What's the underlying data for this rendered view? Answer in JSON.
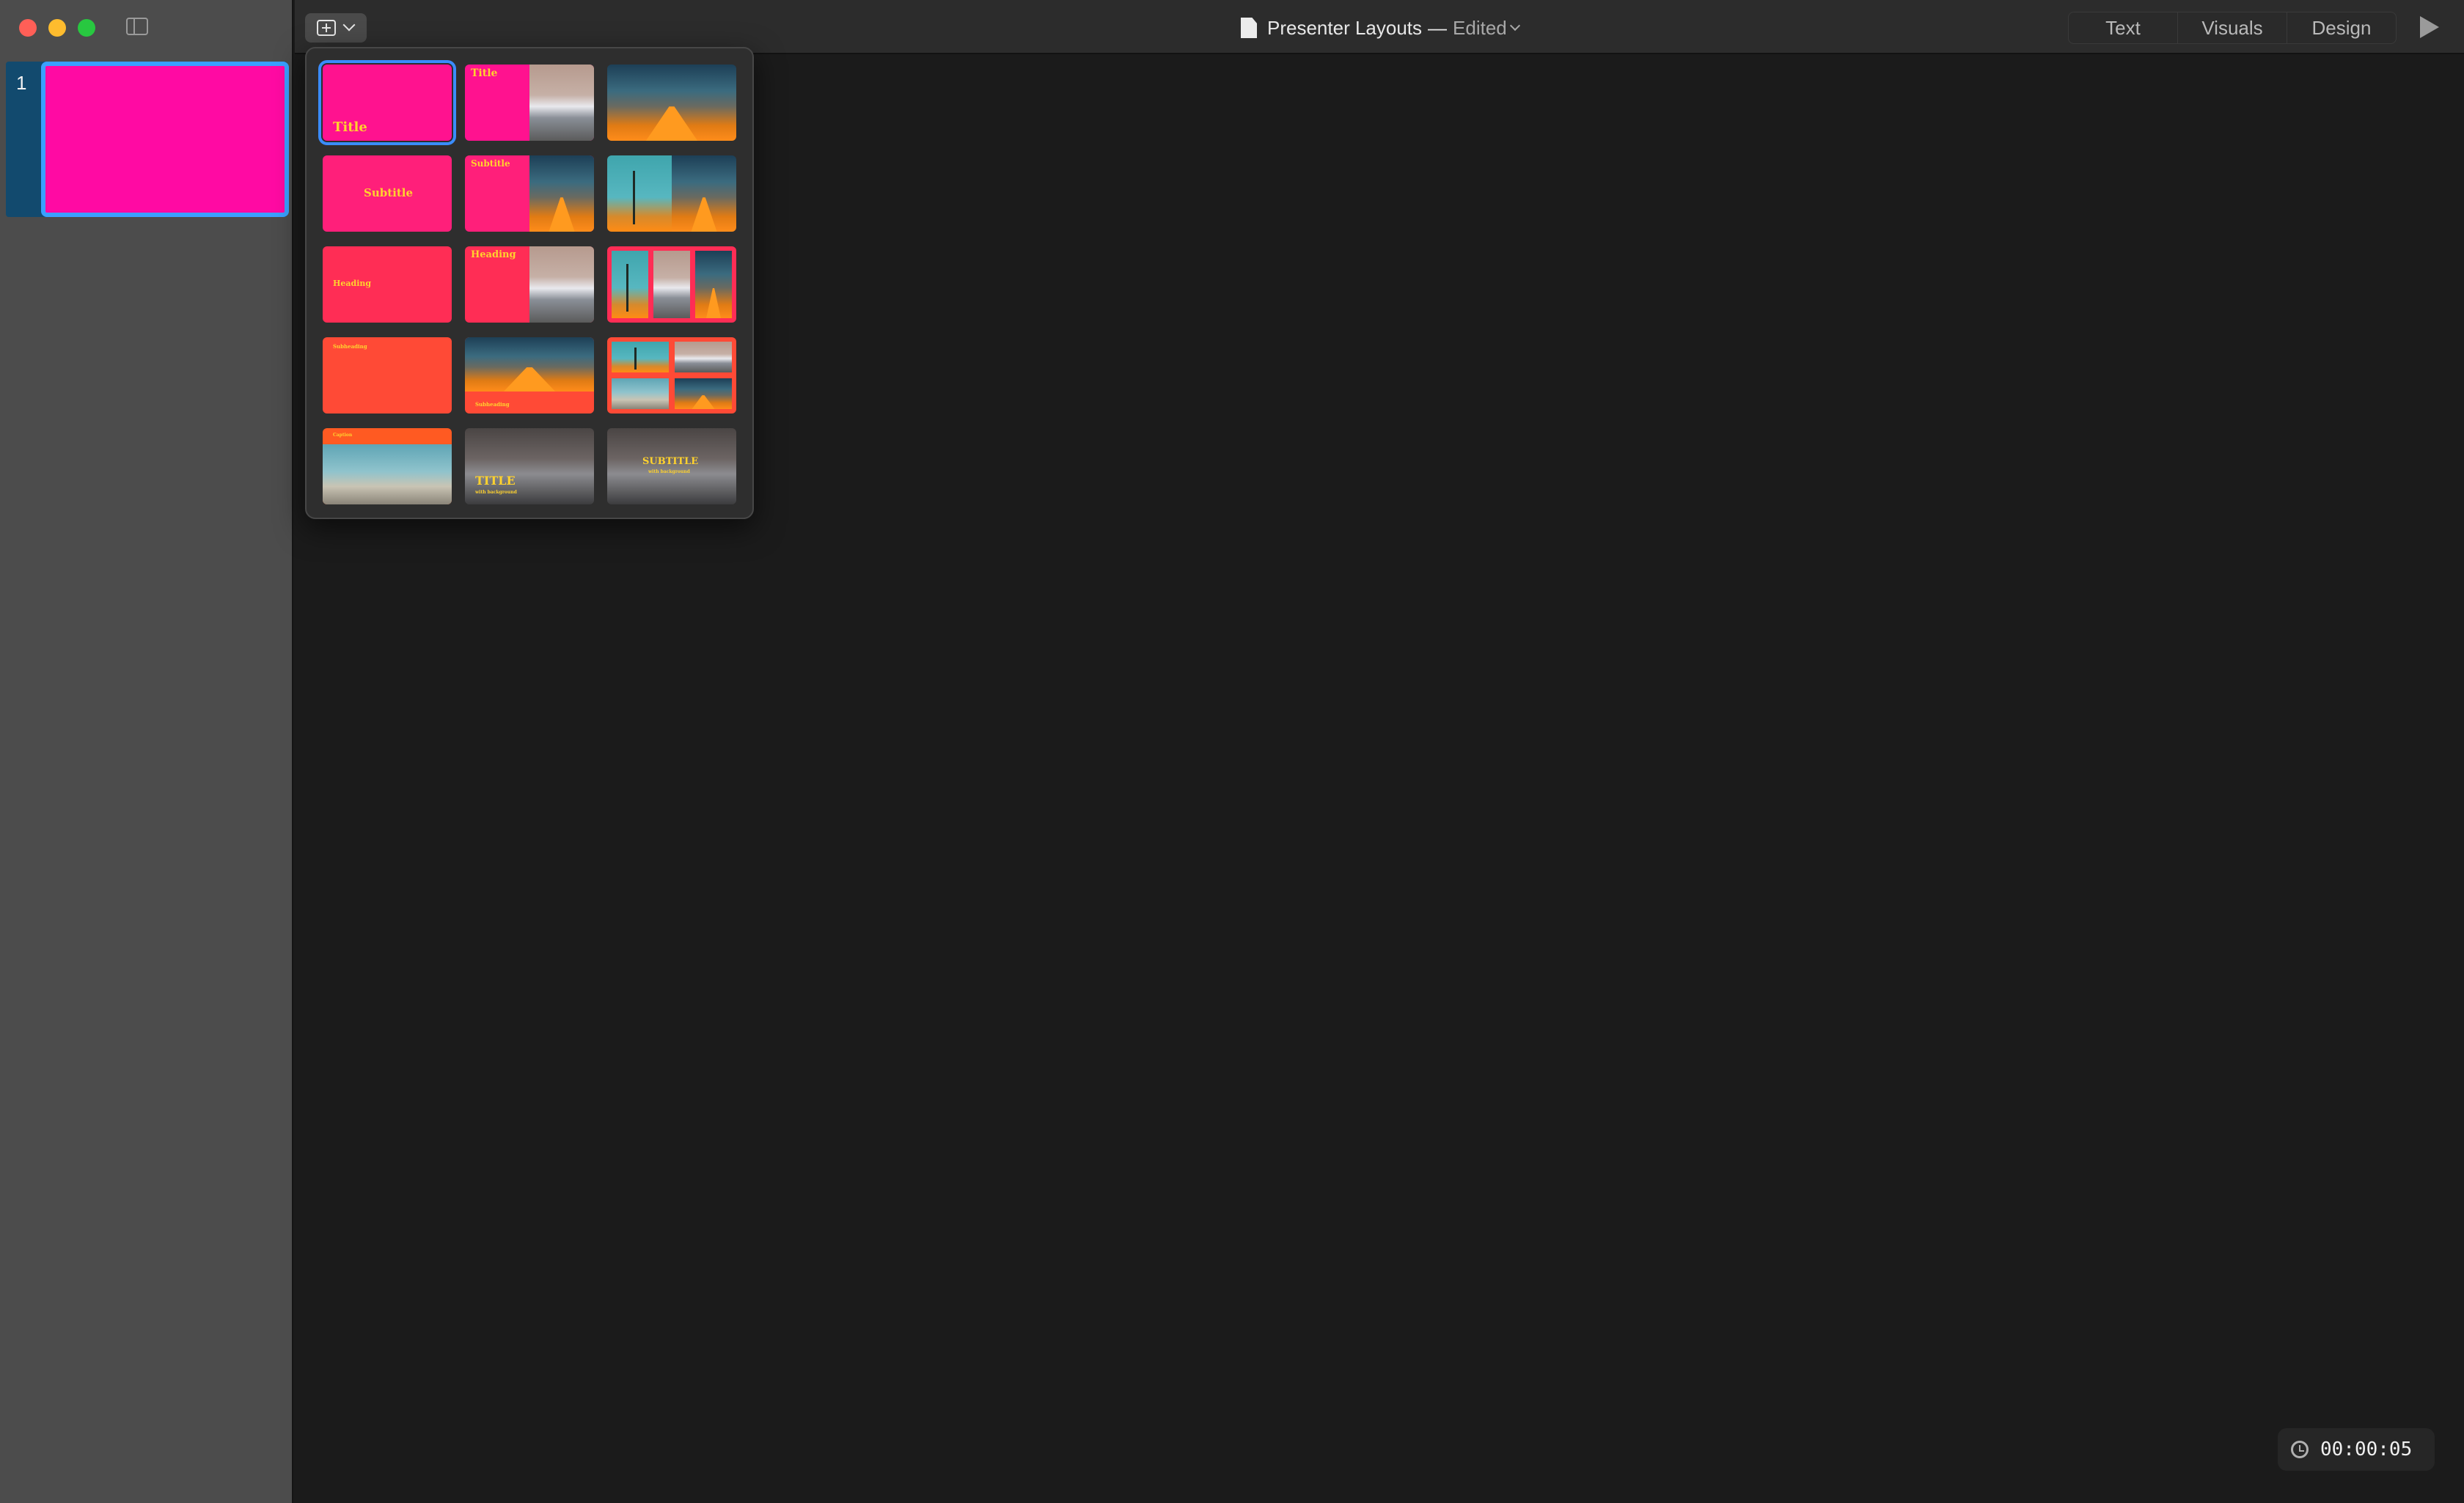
{
  "window": {
    "document_title": "Presenter Layouts",
    "separator": "—",
    "status": "Edited"
  },
  "toolbar": {
    "modes": [
      "Text",
      "Visuals",
      "Design"
    ]
  },
  "sidebar": {
    "slides": [
      {
        "number": "1",
        "color": "#ff0aa3"
      }
    ]
  },
  "layouts": {
    "labels": {
      "l1": "Title",
      "l2": "Title",
      "l4": "Subtitle",
      "l5": "Subtitle",
      "l7": "Heading",
      "l8": "Heading",
      "l10": "Subheading",
      "l11": "Subheading",
      "l13": "Caption",
      "l14": "TITLE",
      "l14_sub": "with background",
      "l15": "SUBTITLE",
      "l15_sub": "with background"
    },
    "colors": {
      "pink": "#ff128f",
      "rose": "#ff2d6e",
      "coral": "#ff3b55",
      "orange": "#ff4a36",
      "accent_selected": "#3a8cff",
      "label_yellow": "#ffd22e"
    }
  },
  "timer": {
    "value": "00:00:05"
  }
}
